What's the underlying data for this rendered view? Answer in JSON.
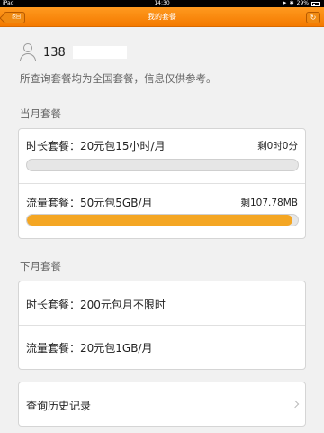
{
  "status_bar": {
    "device": "iPad",
    "time": "14:30",
    "battery": "29%"
  },
  "nav": {
    "title": "我的套餐",
    "back_label": "返回",
    "refresh_icon": "refresh-icon"
  },
  "user": {
    "phone_prefix": "138"
  },
  "notice": "所查询套餐均为全国套餐，信息仅供参考。",
  "current_month": {
    "title": "当月套餐",
    "plans": [
      {
        "label": "时长套餐：20元包15小时/月",
        "remaining": "剩0时0分",
        "used_fraction": 0.0,
        "fill_color": "#f4a623"
      },
      {
        "label": "流量套餐：50元包5GB/月",
        "remaining": "剩107.78MB",
        "used_fraction": 0.98,
        "fill_color": "#f4a623"
      }
    ]
  },
  "next_month": {
    "title": "下月套餐",
    "plans": [
      {
        "label": "时长套餐：200元包月不限时"
      },
      {
        "label": "流量套餐：20元包1GB/月"
      }
    ]
  },
  "history": {
    "label": "查询历史记录"
  },
  "colors": {
    "accent": "#f47a00",
    "bar_track": "#e6e6e6",
    "bar_fill": "#f4a623"
  }
}
